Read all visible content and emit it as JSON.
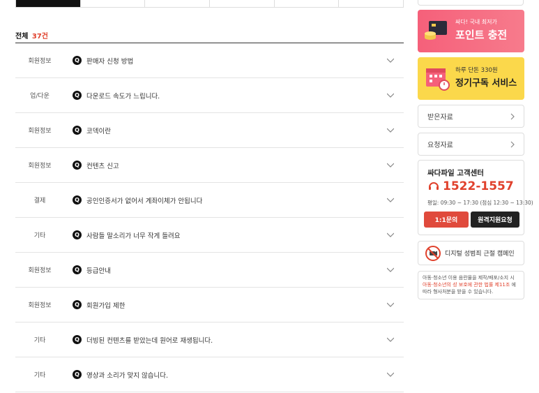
{
  "tabs": [
    "",
    "",
    "",
    "",
    "",
    ""
  ],
  "list_header": {
    "label": "전체",
    "count": "37건"
  },
  "faq_items": [
    {
      "category": "회원정보",
      "badge": "Q",
      "title": "판매자 신청 방법"
    },
    {
      "category": "업/다운",
      "badge": "Q",
      "title": "다운로드 속도가 느립니다."
    },
    {
      "category": "회원정보",
      "badge": "Q",
      "title": "코덱이란"
    },
    {
      "category": "회원정보",
      "badge": "Q",
      "title": "컨텐츠 신고"
    },
    {
      "category": "결제",
      "badge": "Q",
      "title": "공인인증서가 없어서 계좌이체가 안됩니다"
    },
    {
      "category": "기타",
      "badge": "Q",
      "title": "사람들 말소리가 너무 작게 들려요"
    },
    {
      "category": "회원정보",
      "badge": "Q",
      "title": "등급안내"
    },
    {
      "category": "회원정보",
      "badge": "Q",
      "title": "회원가입 제한"
    },
    {
      "category": "기타",
      "badge": "Q",
      "title": "더빙된 컨텐츠를 받았는데 원어로 재생됩니다."
    },
    {
      "category": "기타",
      "badge": "Q",
      "title": "영상과 소리가 맞지 않습니다."
    }
  ],
  "sidebar": {
    "point_banner": {
      "small": "싸다! 국내 최저가",
      "big": "포인트 충전",
      "icon": "coins-card-icon"
    },
    "subscribe_banner": {
      "small": "하루 단돈 330원",
      "big": "정기구독 서비스",
      "icon": "calendar-icon"
    },
    "links": [
      {
        "label": "받은자료",
        "icon": "chevron-right-icon"
      },
      {
        "label": "요청자료",
        "icon": "chevron-right-icon"
      }
    ],
    "cs": {
      "title": "싸다파일 고객센터",
      "phone": "1522-1557",
      "hours": "평일: 09:30 ~ 17:30 (점심 12:30 ~ 13:30)",
      "inquiry_btn": "1:1문의",
      "remote_btn": "원격지원요청",
      "icon": "headset-icon"
    },
    "campaign": {
      "label": "디지털 성범죄 근절 캠페인",
      "icon": "no-camera-icon"
    },
    "notice": {
      "line1": "아동·청소년 이용 음란물을 제작/배포/소지 시",
      "highlight": "아동·청소년의 성 보호에 관한 법률 제11조",
      "line2_tail": " 에",
      "line3": "따라 형사처분을 받을 수 있습니다."
    }
  },
  "colors": {
    "accent": "#e0412c",
    "tab_active": "#111111",
    "point_banner": "#f5607a",
    "subscribe_banner": "#fbd84b"
  }
}
